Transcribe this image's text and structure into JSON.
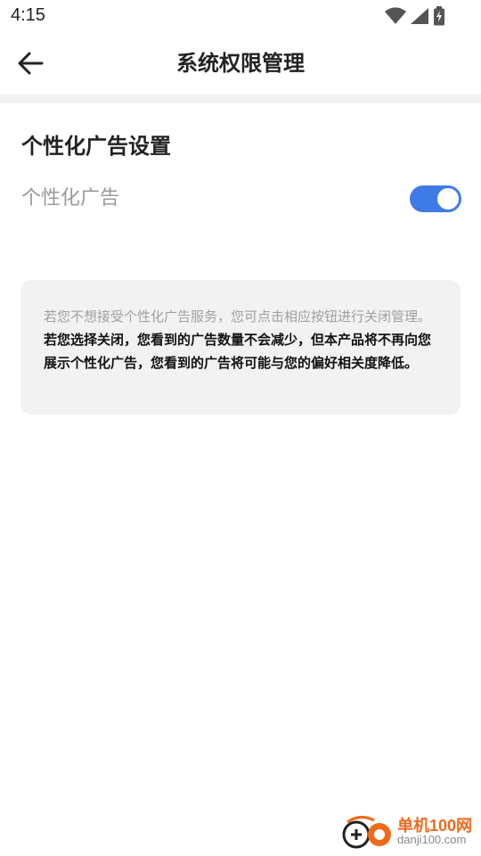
{
  "status_bar": {
    "time": "4:15",
    "icons": [
      "wifi-icon",
      "signal-icon",
      "battery-icon"
    ]
  },
  "header": {
    "title": "系统权限管理",
    "back_icon": "arrow-left-icon"
  },
  "section": {
    "title": "个性化广告设置",
    "setting": {
      "label": "个性化广告",
      "enabled": true,
      "accent_color": "#3f7be6"
    }
  },
  "info": {
    "text_normal": "若您不想接受个性化广告服务，您可点击相应按钮进行关闭管理。",
    "text_bold": "若您选择关闭，您看到的广告数量不会减少，但本产品将不再向您展示个性化广告，您看到的广告将可能与您的偏好相关度降低。"
  },
  "watermark": {
    "name": "单机100网",
    "url": "danji100.com"
  }
}
